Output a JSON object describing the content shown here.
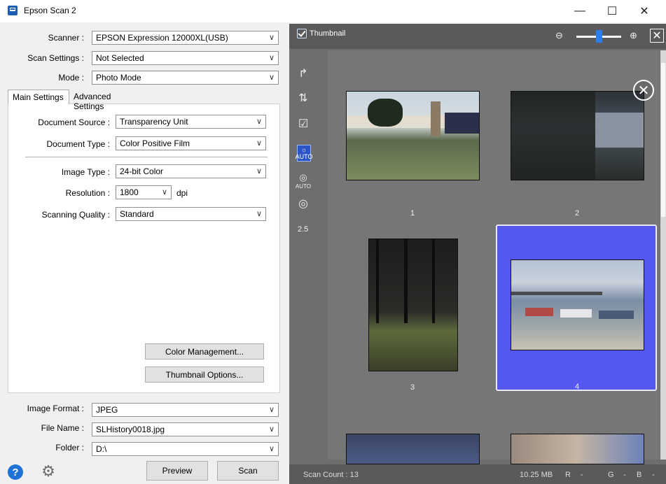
{
  "window": {
    "title": "Epson Scan 2",
    "min_glyph": "—",
    "max_glyph": "☐",
    "close_glyph": "✕"
  },
  "top": {
    "scanner_label": "Scanner :",
    "scanner_value": "EPSON Expression 12000XL(USB)",
    "scan_settings_label": "Scan Settings :",
    "scan_settings_value": "Not Selected",
    "mode_label": "Mode :",
    "mode_value": "Photo Mode"
  },
  "tabs": {
    "main": "Main Settings",
    "advanced": "Advanced Settings"
  },
  "main": {
    "doc_source_label": "Document Source :",
    "doc_source_value": "Transparency Unit",
    "doc_type_label": "Document Type :",
    "doc_type_value": "Color Positive Film",
    "image_type_label": "Image Type :",
    "image_type_value": "24-bit Color",
    "resolution_label": "Resolution :",
    "resolution_value": "1800",
    "resolution_unit": "dpi",
    "quality_label": "Scanning Quality :",
    "quality_value": "Standard",
    "color_mgmt_button": "Color Management...",
    "thumb_options_button": "Thumbnail Options..."
  },
  "bottom": {
    "format_label": "Image Format :",
    "format_value": "JPEG",
    "filename_label": "File Name :",
    "filename_value": "SLHistory0018.jpg",
    "folder_label": "Folder :",
    "folder_value": "D:\\",
    "preview_button": "Preview",
    "scan_button": "Scan"
  },
  "preview": {
    "thumbnail_label": "Thumbnail",
    "sidebar_zoom_text": "2.5",
    "auto_text": "AUTO",
    "thumbnails": [
      {
        "number": "1"
      },
      {
        "number": "2"
      },
      {
        "number": "3"
      },
      {
        "number": "4"
      }
    ]
  },
  "status": {
    "scan_count": "Scan Count : 13",
    "size": "10.25 MB",
    "r": "R",
    "r_val": "-",
    "g": "G",
    "g_val": "-",
    "b": "B",
    "b_val": "-"
  },
  "colors": {
    "accent": "#2b7de9",
    "selection": "#5457f0",
    "panel_dark": "#6e6e6e"
  },
  "icons": [
    "app-icon",
    "help-icon",
    "gear-icon",
    "zoom-out-icon",
    "zoom-in-icon",
    "close-icon",
    "rotate-icon",
    "auto-exposure-icon"
  ]
}
